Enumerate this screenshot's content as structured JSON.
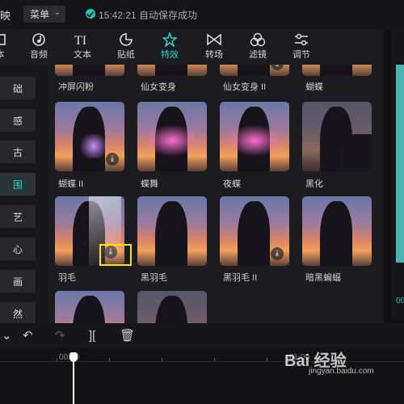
{
  "topbar": {
    "app_fragment": "映",
    "menu_label": "菜单",
    "menu_chevron": "⌄",
    "save_status": "15:42:21 自动保存成功"
  },
  "tabs": [
    {
      "label": "本",
      "icon": "media-icon"
    },
    {
      "label": "音频",
      "icon": "audio-icon"
    },
    {
      "label": "文本",
      "icon": "text-icon"
    },
    {
      "label": "贴纸",
      "icon": "sticker-icon"
    },
    {
      "label": "特效",
      "icon": "effects-icon",
      "active": true
    },
    {
      "label": "转场",
      "icon": "transition-icon"
    },
    {
      "label": "滤镜",
      "icon": "filter-icon"
    },
    {
      "label": "调节",
      "icon": "adjust-icon"
    }
  ],
  "categories": [
    "础",
    "感",
    "古",
    "围",
    "艺",
    "心",
    "画",
    "然"
  ],
  "active_category": "围",
  "effects_row0": [
    "冲屏闪粉",
    "仙女变身",
    "仙女变身 II",
    "蝴蝶"
  ],
  "effects_row1": [
    "蝴蝶 II",
    "蝶舞",
    "夜蝶",
    "黑化"
  ],
  "effects_row2": [
    "羽毛",
    "黑羽毛",
    "黑羽毛 II",
    "暗黑蝙蝠"
  ],
  "download_glyph": "⤓",
  "timeline": {
    "marker_start": "00:00",
    "marker_next": "01:00"
  },
  "preview": {
    "time_fragment": "00"
  },
  "watermark": {
    "brand": "Bai 经验",
    "url": "jingyan.baidu.com"
  },
  "colors": {
    "accent": "#22d3c5",
    "highlight": "#ffe600"
  }
}
